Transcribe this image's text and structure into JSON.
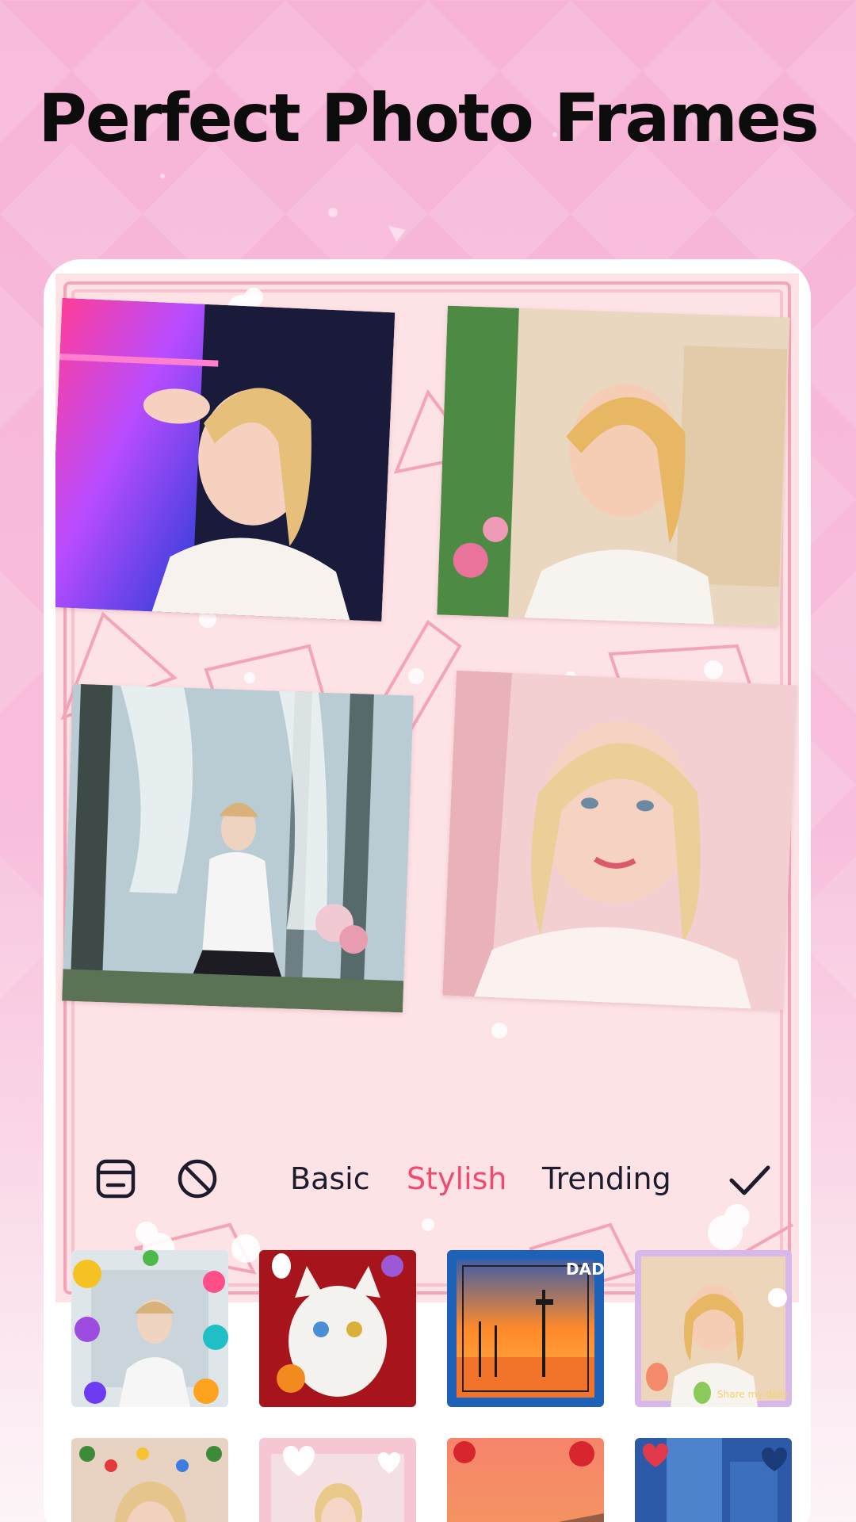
{
  "headline": "Perfect Photo Frames",
  "toolbar": {
    "frame_icon": "frame-style-icon",
    "none_icon": "no-frame-icon",
    "tabs": [
      {
        "label": "Basic",
        "active": false
      },
      {
        "label": "Stylish",
        "active": true
      },
      {
        "label": "Trending",
        "active": false
      }
    ],
    "confirm_icon": "checkmark-icon"
  },
  "frames": [
    {
      "name": "doodle-frame"
    },
    {
      "name": "halloween-frame"
    },
    {
      "name": "dad-sunset-frame"
    },
    {
      "name": "balloon-frame",
      "caption": "Share my daily"
    },
    {
      "name": "christmas-lights-frame"
    },
    {
      "name": "hearts-frame"
    },
    {
      "name": "roses-frame"
    },
    {
      "name": "blue-hearts-frame"
    }
  ],
  "frame_badge": "DAD",
  "colors": {
    "accent": "#f04a6e",
    "background": "#f7b3d6",
    "canvas": "#fde3e6",
    "text": "#1c1c2c"
  }
}
